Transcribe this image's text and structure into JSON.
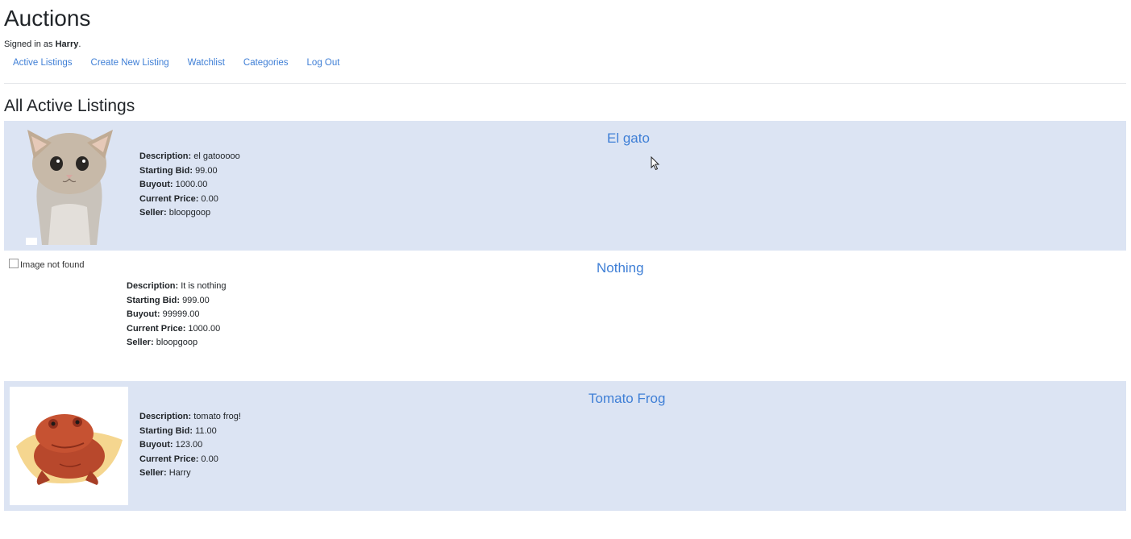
{
  "header": {
    "title": "Auctions",
    "signed_in_prefix": "Signed in as",
    "user": "Harry",
    "signed_in_suffix": "."
  },
  "nav": [
    {
      "label": "Active Listings"
    },
    {
      "label": "Create New Listing"
    },
    {
      "label": "Watchlist"
    },
    {
      "label": "Categories"
    },
    {
      "label": "Log Out"
    }
  ],
  "main": {
    "heading": "All Active Listings"
  },
  "field_labels": {
    "description": "Description:",
    "starting_bid": "Starting Bid:",
    "buyout": "Buyout:",
    "current_price": "Current Price:",
    "seller": "Seller:"
  },
  "listings": [
    {
      "title": "El gato",
      "description": "el gatooooo",
      "starting_bid": "99.00",
      "buyout": "1000.00",
      "current_price": "0.00",
      "seller": "bloopgoop"
    },
    {
      "title": "Nothing",
      "image_alt": "Image not found",
      "description": "It is nothing",
      "starting_bid": "999.00",
      "buyout": "99999.00",
      "current_price": "1000.00",
      "seller": "bloopgoop"
    },
    {
      "title": "Tomato Frog",
      "description": "tomato frog!",
      "starting_bid": "11.00",
      "buyout": "123.00",
      "current_price": "0.00",
      "seller": "Harry"
    }
  ],
  "colors": {
    "link": "#3f7fd6",
    "listing_bg": "#dce4f3"
  },
  "icons": {
    "cursor": "mouse-pointer-icon"
  }
}
